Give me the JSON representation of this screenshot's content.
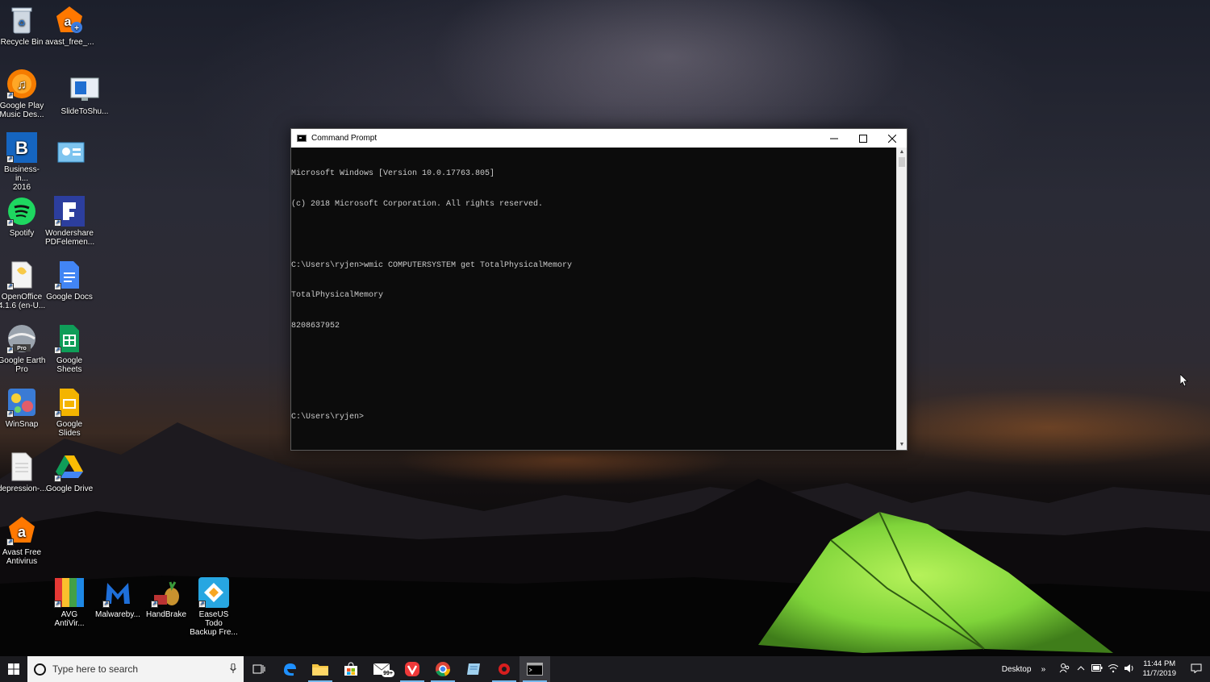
{
  "desktop": {
    "icons": [
      {
        "label_1": "Recycle Bin",
        "label_2": ""
      },
      {
        "label_1": "avast_free_...",
        "label_2": ""
      },
      {
        "label_1": "Google Play",
        "label_2": "Music Des..."
      },
      {
        "label_1": "SlideToShu...",
        "label_2": ""
      },
      {
        "label_1": "Business-in...",
        "label_2": "2016"
      },
      {
        "label_1": "",
        "label_2": ""
      },
      {
        "label_1": "Spotify",
        "label_2": ""
      },
      {
        "label_1": "Wondershare",
        "label_2": "PDFelemen..."
      },
      {
        "label_1": "OpenOffice",
        "label_2": "4.1.6 (en-U..."
      },
      {
        "label_1": "Google Docs",
        "label_2": ""
      },
      {
        "label_1": "Google Earth",
        "label_2": "Pro"
      },
      {
        "label_1": "Google",
        "label_2": "Sheets"
      },
      {
        "label_1": "WinSnap",
        "label_2": ""
      },
      {
        "label_1": "Google Slides",
        "label_2": ""
      },
      {
        "label_1": "depression-...",
        "label_2": ""
      },
      {
        "label_1": "Google Drive",
        "label_2": ""
      },
      {
        "label_1": "Avast Free",
        "label_2": "Antivirus"
      },
      {
        "label_1": "AVG",
        "label_2": "AntiVir..."
      },
      {
        "label_1": "Malwareby...",
        "label_2": ""
      },
      {
        "label_1": "HandBrake",
        "label_2": ""
      },
      {
        "label_1": "EaseUS Todo",
        "label_2": "Backup Fre..."
      }
    ]
  },
  "cmd": {
    "title": "Command Prompt",
    "lines": [
      "Microsoft Windows [Version 10.0.17763.805]",
      "(c) 2018 Microsoft Corporation. All rights reserved.",
      "",
      "C:\\Users\\ryjen>wmic COMPUTERSYSTEM get TotalPhysicalMemory",
      "TotalPhysicalMemory",
      "8208637952",
      "",
      "",
      "C:\\Users\\ryjen>"
    ]
  },
  "taskbar": {
    "search_placeholder": "Type here to search",
    "mail_badge": "99+",
    "desktop_label": "Desktop",
    "time": "11:44 PM",
    "date": "11/7/2019"
  },
  "colors": {
    "taskbar_bg": "#1b1b1f",
    "console_bg": "#0c0c0c",
    "console_text": "#cccccc",
    "running_indicator": "#76b9ed",
    "tent_green": "#7fd43a"
  }
}
